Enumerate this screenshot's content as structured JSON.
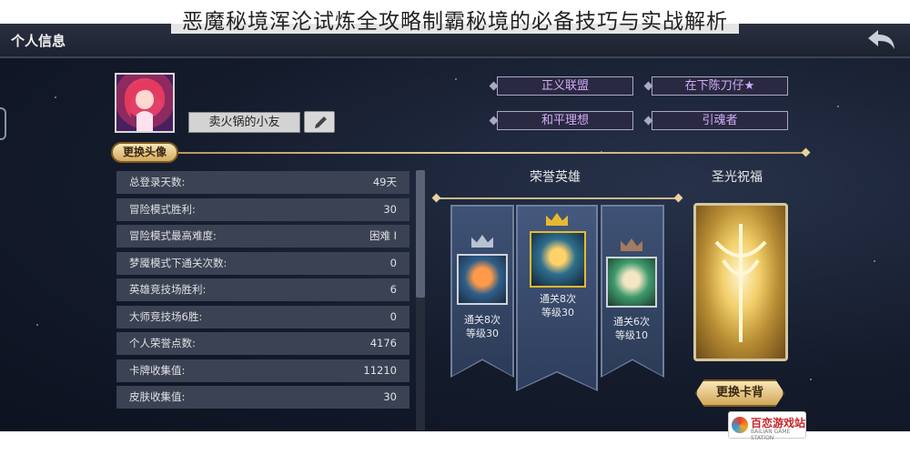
{
  "overlay_title": "恶魔秘境浑沦试炼全攻略制霸秘境的必备技巧与实战解析",
  "header": {
    "title": "个人信息"
  },
  "profile": {
    "name": "卖火锅的小友",
    "change_avatar_label": "更换头像"
  },
  "tags": [
    {
      "label": "正义联盟"
    },
    {
      "label": "在下陈刀仔★"
    },
    {
      "label": "和平理想"
    },
    {
      "label": "引魂者"
    }
  ],
  "stats": [
    {
      "label": "总登录天数:",
      "value": "49天"
    },
    {
      "label": "冒险模式胜利:",
      "value": "30"
    },
    {
      "label": "冒险模式最高难度:",
      "value": "困难 I"
    },
    {
      "label": "梦魇模式下通关次数:",
      "value": "0"
    },
    {
      "label": "英雄竞技场胜利:",
      "value": "6"
    },
    {
      "label": "大师竞技场6胜:",
      "value": "0"
    },
    {
      "label": "个人荣誉点数:",
      "value": "4176"
    },
    {
      "label": "卡牌收集值:",
      "value": "11210"
    },
    {
      "label": "皮肤收集值:",
      "value": "30"
    }
  ],
  "honor_heroes": {
    "title": "荣誉英雄",
    "heroes": [
      {
        "line1": "通关8次",
        "line2": "等级30",
        "crown": "silver"
      },
      {
        "line1": "通关8次",
        "line2": "等级30",
        "crown": "gold"
      },
      {
        "line1": "通关6次",
        "line2": "等级10",
        "crown": "bronze"
      }
    ]
  },
  "blessing": {
    "title": "圣光祝福",
    "change_back_label": "更换卡背"
  },
  "watermark": {
    "name": "百恋游戏站",
    "sub": "BAILIAN GAME STATION"
  },
  "colors": {
    "gold_crown": "#e8b92f",
    "silver_crown": "#b7c3d2",
    "bronze_crown": "#a57a62",
    "tag_text": "#d1adf5"
  }
}
